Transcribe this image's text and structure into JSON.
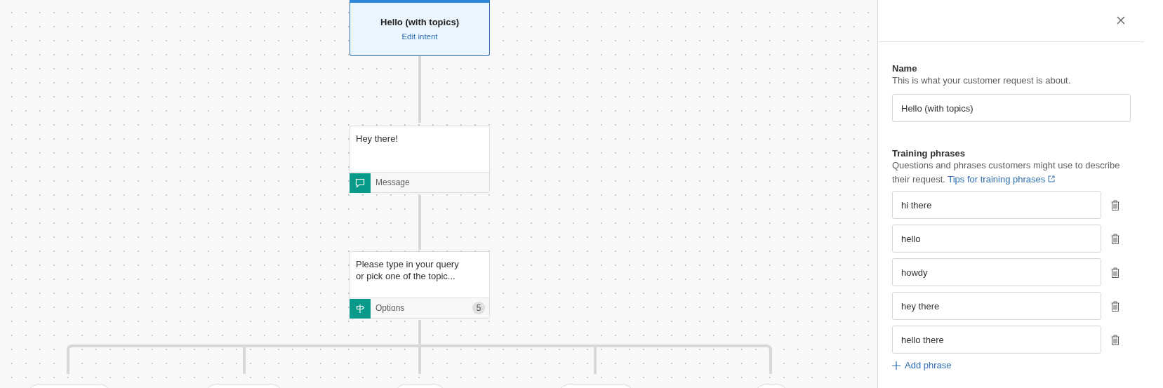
{
  "canvas": {
    "trigger": {
      "title": "Hello (with topics)",
      "link": "Edit intent",
      "selected": true
    },
    "nodes": [
      {
        "kind": "message",
        "text": "Hey there!",
        "type_label": "Message"
      },
      {
        "kind": "options",
        "text": "Please type in your query\nor pick one of the topic...",
        "type_label": "Options",
        "count": "5"
      }
    ]
  },
  "panel": {
    "name": {
      "label": "Name",
      "description": "This is what your customer request is about.",
      "value": "Hello (with topics)"
    },
    "training": {
      "label": "Training phrases",
      "description": "Questions and phrases customers might use to describe their request.",
      "link": "Tips for training phrases",
      "phrases": [
        "hi there",
        "hello",
        "howdy",
        "hey there",
        "hello there"
      ],
      "add_label": "Add phrase"
    }
  }
}
